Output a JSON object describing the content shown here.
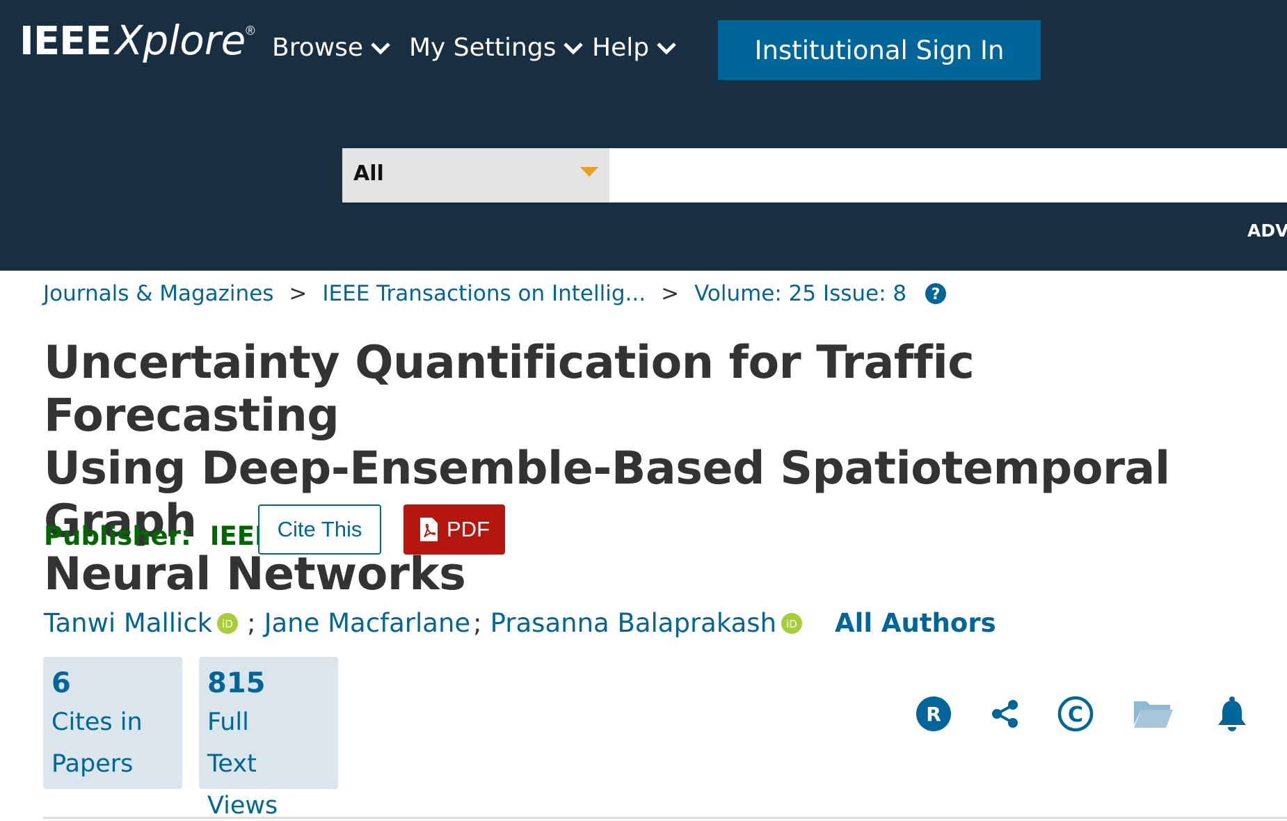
{
  "header": {
    "logo_ieee": "IEEE",
    "logo_xplore": "Xplore",
    "logo_reg": "®",
    "nav": [
      {
        "label": "Browse"
      },
      {
        "label": "My Settings"
      },
      {
        "label": "Help"
      }
    ],
    "institutional_sign_in": "Institutional Sign In",
    "search": {
      "scope_selected": "All",
      "query": "",
      "placeholder": ""
    },
    "advanced_link": "ADVA"
  },
  "breadcrumb": [
    "Journals & Magazines",
    "IEEE Transactions on Intellig...",
    "Volume: 25 Issue: 8"
  ],
  "breadcrumb_separator": ">",
  "article": {
    "title_lines": [
      "Uncertainty Quantification for Traffic Forecasting",
      "Using Deep-Ensemble-Based Spatiotemporal Graph",
      "Neural Networks"
    ],
    "publisher_label": "Publisher:",
    "publisher": "IEEE",
    "cite_button": "Cite This",
    "pdf_button": "PDF"
  },
  "authors": {
    "list": [
      "Tanwi Mallick",
      "Jane Macfarlane",
      "Prasanna Balaprakash"
    ],
    "separator": ";",
    "all_authors": "All Authors"
  },
  "metrics": [
    {
      "value": "6",
      "label_line1": "Cites in",
      "label_line2": "Papers"
    },
    {
      "value": "815",
      "label_line1": "Full",
      "label_line2": "Text Views"
    }
  ],
  "colors": {
    "header_bg": "#172f40",
    "accent_blue": "#006699",
    "pdf_red": "#b5170f",
    "publisher_green": "#006600",
    "orcid_green": "#a6ce39",
    "caret_orange": "#e8a020",
    "metric_bg": "#dbe6ec"
  },
  "icons": [
    "chevron-down-icon",
    "caret-down-icon",
    "question-circle-icon",
    "pdf-file-icon",
    "orcid-icon",
    "rights-r-icon",
    "share-icon",
    "copyright-icon",
    "folder-icon",
    "bell-icon"
  ]
}
